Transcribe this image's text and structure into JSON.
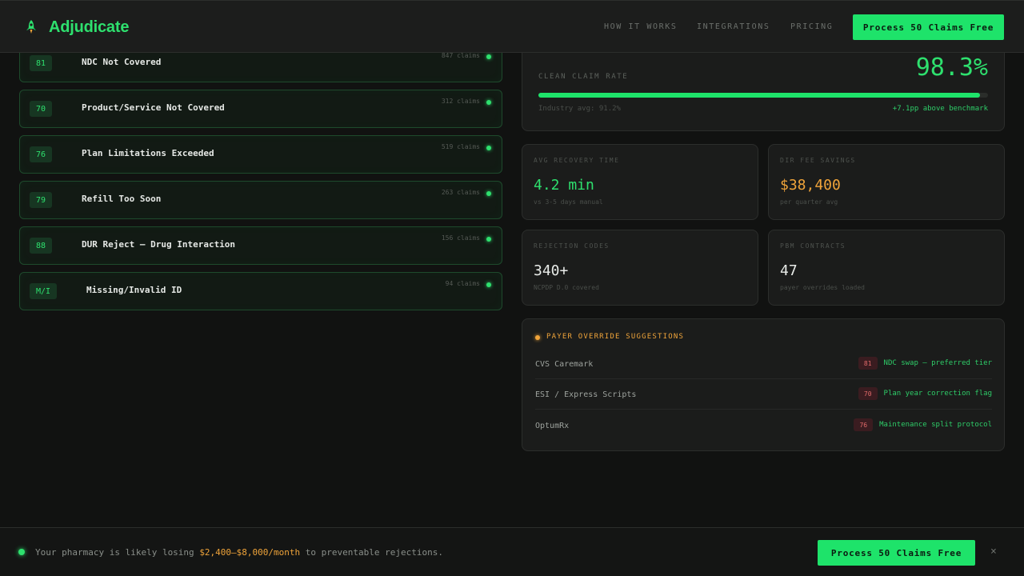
{
  "header": {
    "brand": "Adjudicate",
    "nav": [
      "HOW IT WORKS",
      "INTEGRATIONS",
      "PRICING"
    ],
    "cta": "Process 50 Claims Free"
  },
  "rejections": [
    {
      "code": "81",
      "label": "NDC Not Covered",
      "count": "847 claims"
    },
    {
      "code": "70",
      "label": "Product/Service Not Covered",
      "count": "312 claims"
    },
    {
      "code": "76",
      "label": "Plan Limitations Exceeded",
      "count": "519 claims"
    },
    {
      "code": "79",
      "label": "Refill Too Soon",
      "count": "263 claims"
    },
    {
      "code": "88",
      "label": "DUR Reject — Drug Interaction",
      "count": "156 claims"
    },
    {
      "code": "M/I",
      "label": "Missing/Invalid ID",
      "count": "94 claims"
    }
  ],
  "clean_claim": {
    "label": "CLEAN CLAIM RATE",
    "value": "98.3%",
    "progress_percent": 98.3,
    "industry": "Industry avg: 91.2%",
    "benchmark": "+7.1pp above benchmark"
  },
  "stats": [
    {
      "label": "AVG RECOVERY TIME",
      "value": "4.2 min",
      "sub": "vs 3-5 days manual"
    },
    {
      "label": "DIR FEE SAVINGS",
      "value": "$38,400",
      "sub": "per quarter avg"
    },
    {
      "label": "REJECTION CODES",
      "value": "340+",
      "sub": "NCPDP D.0 covered"
    },
    {
      "label": "PBM CONTRACTS",
      "value": "47",
      "sub": "payer overrides loaded"
    }
  ],
  "payer_overrides": {
    "title": "PAYER OVERRIDE SUGGESTIONS",
    "rows": [
      {
        "payer": "CVS Caremark",
        "code": "81",
        "action": "NDC swap — preferred tier"
      },
      {
        "payer": "ESI / Express Scripts",
        "code": "70",
        "action": "Plan year correction flag"
      },
      {
        "payer": "OptumRx",
        "code": "76",
        "action": "Maintenance split protocol"
      }
    ]
  },
  "banner": {
    "text_before": "Your pharmacy is likely losing ",
    "highlight": "$2,400–$8,000/month",
    "text_after": " to preventable rejections.",
    "cta": "Process 50 Claims Free",
    "close": "×"
  },
  "colors": {
    "accent": "#1ee36a",
    "amber": "#f0a43a",
    "danger": "#e06a6a",
    "background": "#111211"
  },
  "icons": [
    "rocket-icon",
    "status-dot-icon",
    "close-icon"
  ]
}
